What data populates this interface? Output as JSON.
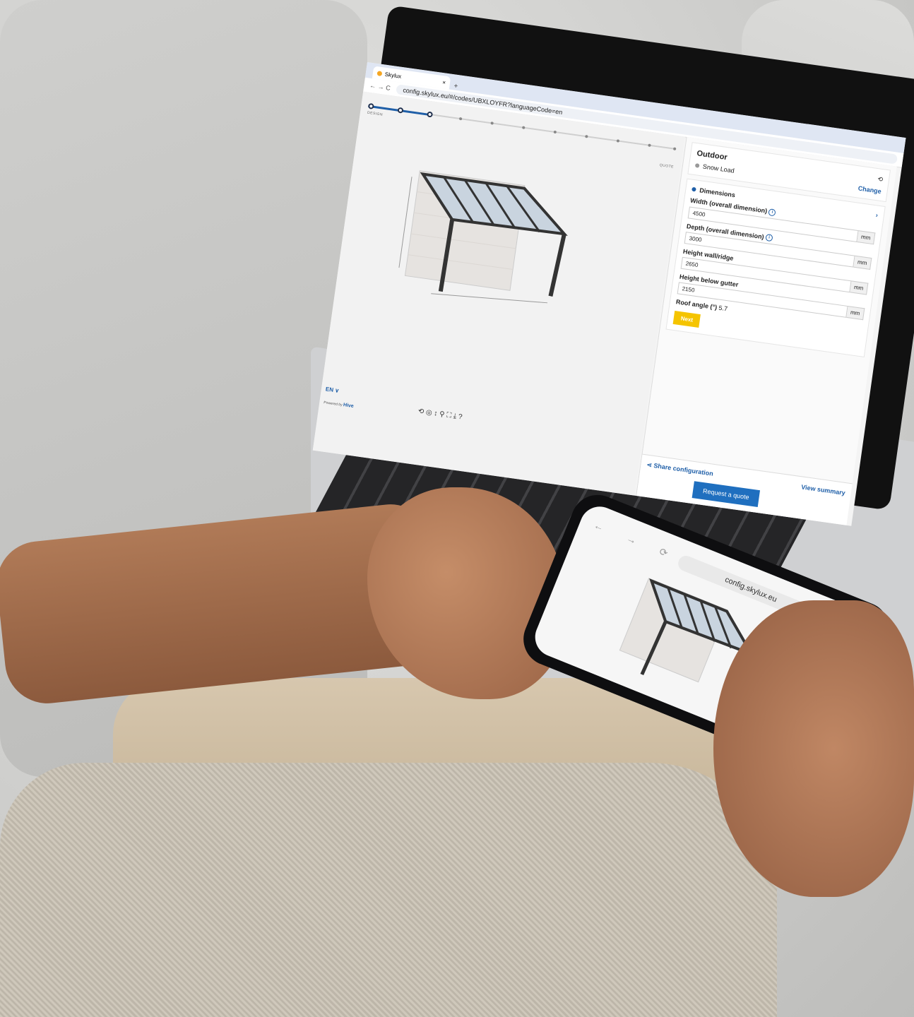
{
  "browser": {
    "tab_title": "Skylux",
    "tab_close": "×",
    "new_tab": "+",
    "nav": "← → C",
    "url": "config.skylux.eu/#/codes/UBXLOYFR?languageCode=en"
  },
  "stepper": {
    "start_label": "DESIGN",
    "end_label": "QUOTE"
  },
  "viewer": {
    "language": "EN ∨",
    "powered_by": "Powered by",
    "powered_brand": "Hive",
    "toolbar_icons": "⟲ ◎ ↕ ⚲ ⛶ ⤓ ?"
  },
  "panel": {
    "outdoor_title": "Outdoor",
    "snow_load": "Snow Load",
    "change": "Change",
    "dimensions": "Dimensions",
    "fields": [
      {
        "label": "Width (overall dimension)",
        "value": "4500",
        "unit": "mm"
      },
      {
        "label": "Depth (overall dimension)",
        "value": "3000",
        "unit": "mm"
      },
      {
        "label": "Height wall/ridge",
        "value": "2650",
        "unit": "mm"
      },
      {
        "label": "Height below gutter",
        "value": "2150",
        "unit": "mm"
      }
    ],
    "roof_angle_label": "Roof angle (°)",
    "roof_angle_value": "5.7",
    "next": "Next",
    "share": "Share configuration",
    "view_summary": "View summary",
    "request_quote": "Request a quote"
  },
  "phone": {
    "url": "config.skylux.eu",
    "nav": "← → ⟳",
    "icons": "⇧ ⧉ ⋯",
    "close": "×"
  }
}
